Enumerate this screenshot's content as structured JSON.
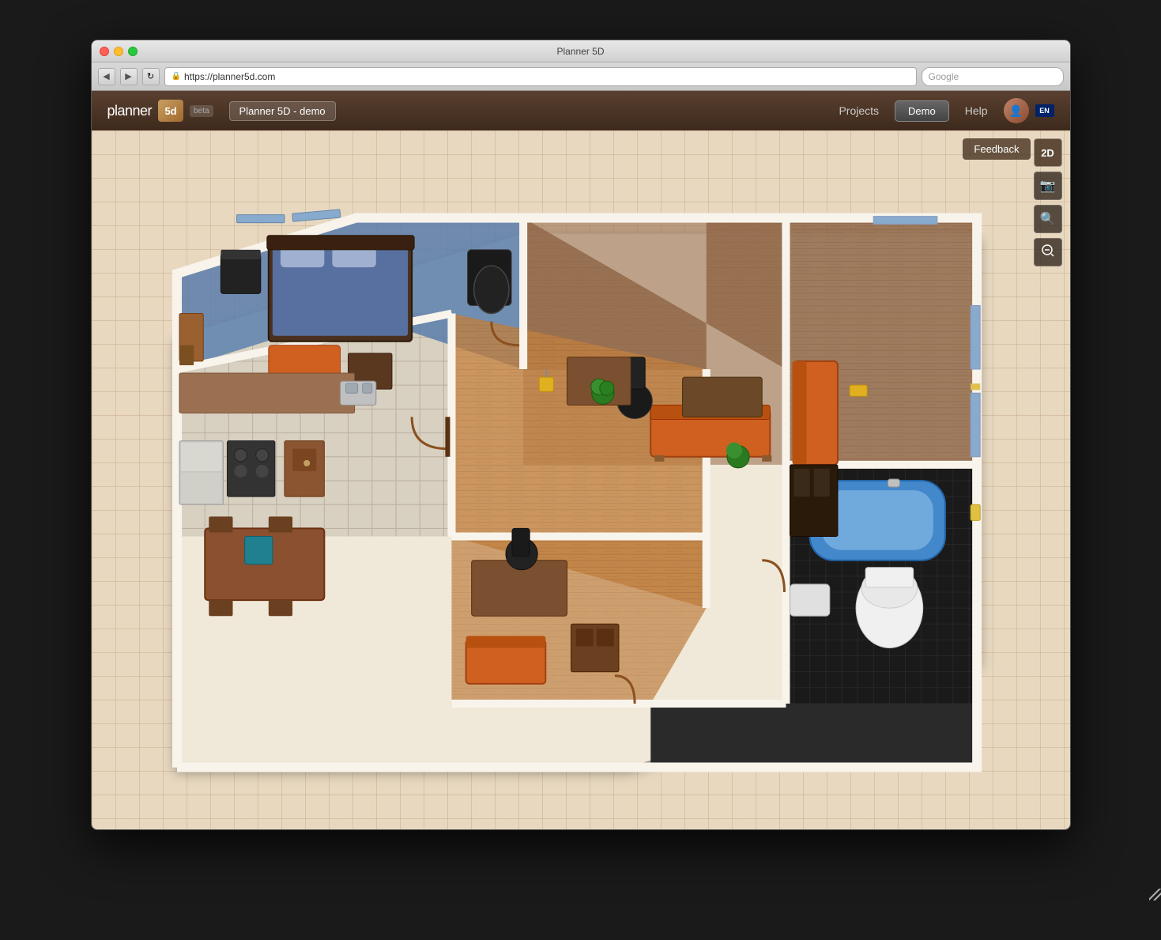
{
  "window": {
    "title": "Planner 5D",
    "traffic_lights": [
      "red",
      "yellow",
      "green"
    ]
  },
  "browser": {
    "url": "https://planner5d.com",
    "search_placeholder": "Google",
    "search_text": "Google",
    "back_icon": "◀",
    "forward_icon": "▶",
    "reload_icon": "↻"
  },
  "header": {
    "logo_text": "planner",
    "logo_number": "5d",
    "beta_label": "beta",
    "project_name": "Planner 5D - demo",
    "nav_items": [
      "Projects",
      "Demo",
      "Help"
    ],
    "demo_label": "Demo"
  },
  "toolbar": {
    "view_2d_label": "2D",
    "screenshot_icon": "camera",
    "zoom_in_icon": "zoom-in",
    "zoom_out_icon": "zoom-out"
  },
  "feedback": {
    "label": "Feedback"
  },
  "floorplan": {
    "description": "3D isometric view of apartment floor plan",
    "rooms": [
      "bedroom",
      "living_room",
      "kitchen",
      "bathroom",
      "hallway",
      "study"
    ]
  }
}
